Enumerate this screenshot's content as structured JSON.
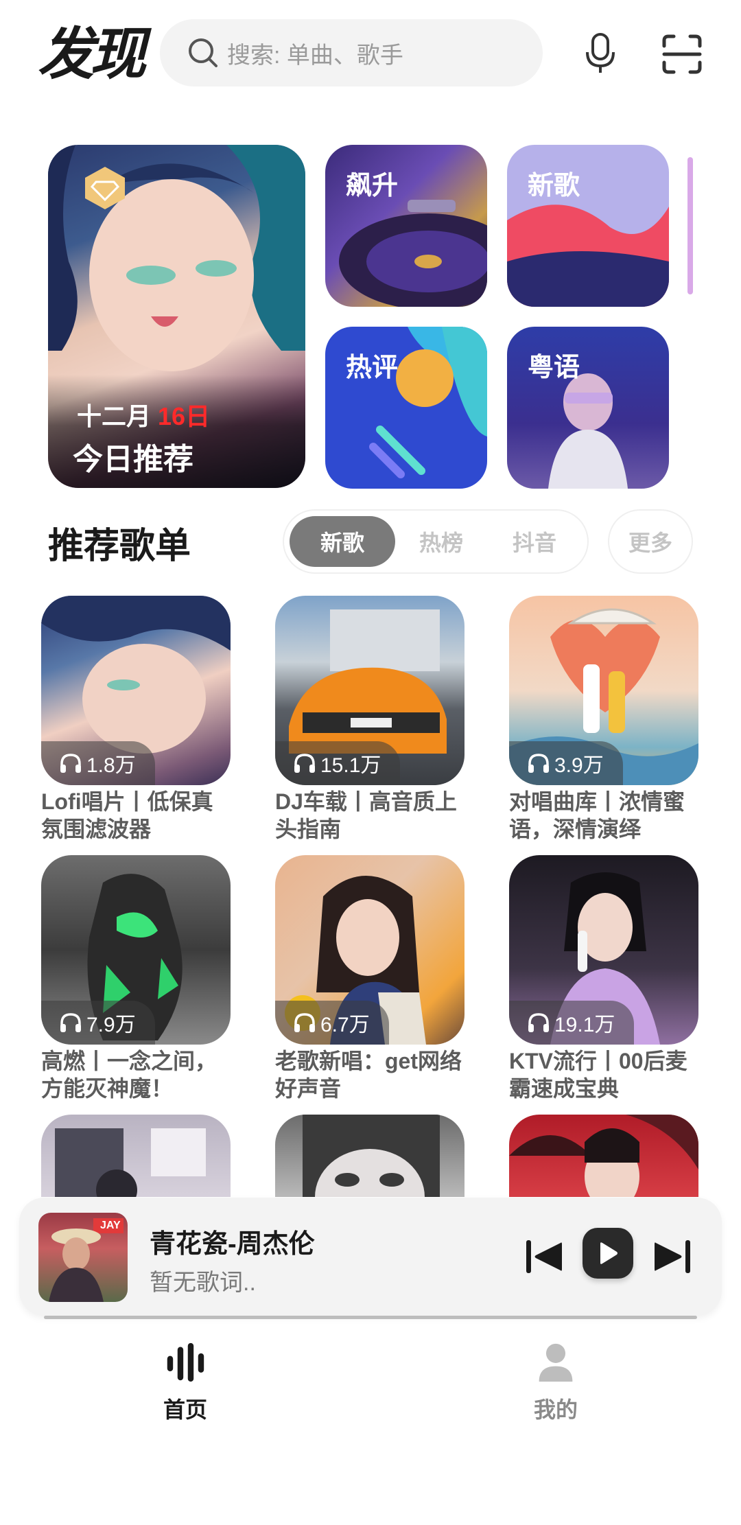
{
  "header": {
    "title": "发现",
    "search_placeholder": "搜索: 单曲、歌手",
    "icons": [
      "search-icon",
      "microphone-icon",
      "scan-icon"
    ]
  },
  "banner": {
    "main": {
      "date_month": "十二月",
      "date_day": "16日",
      "label": "今日推荐",
      "badge_icon": "diamond-icon"
    },
    "tiles": [
      {
        "label": "飙升"
      },
      {
        "label": "新歌"
      },
      {
        "label": "热评"
      },
      {
        "label": "粤语"
      }
    ]
  },
  "recommend": {
    "title": "推荐歌单",
    "tabs": [
      "新歌",
      "热榜",
      "抖音"
    ],
    "active_tab": "新歌",
    "more": "更多",
    "playlists": [
      {
        "plays": "1.8万",
        "title": "Lofi唱片丨低保真氛围滤波器"
      },
      {
        "plays": "15.1万",
        "title": "DJ车载丨高音质上头指南"
      },
      {
        "plays": "3.9万",
        "title": "对唱曲库丨浓情蜜语，深情演绎"
      },
      {
        "plays": "7.9万",
        "title": "高燃丨一念之间，方能灭神魔！"
      },
      {
        "plays": "6.7万",
        "title": "老歌新唱：get网络好声音"
      },
      {
        "plays": "19.1万",
        "title": "KTV流行丨00后麦霸速成宝典"
      }
    ]
  },
  "player": {
    "song": "青花瓷-周杰伦",
    "lyric": "暂无歌词..",
    "album_text": "JAY",
    "controls": [
      "previous-icon",
      "play-icon",
      "next-icon"
    ]
  },
  "nav": {
    "items": [
      {
        "label": "首页",
        "icon": "wave-icon",
        "active": true
      },
      {
        "label": "我的",
        "icon": "person-icon",
        "active": false
      }
    ]
  },
  "colors": {
    "accent_day": "#ff2a2a",
    "pill_active": "#7a7a7a",
    "search_bg": "#f3f3f3"
  }
}
